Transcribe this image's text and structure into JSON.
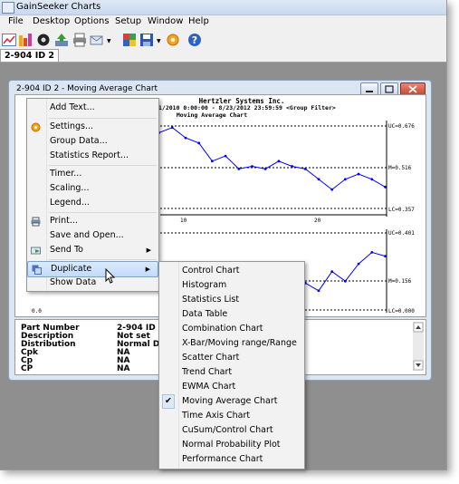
{
  "app": {
    "title": "GainSeeker Charts"
  },
  "menubar": [
    "File",
    "Desktop",
    "Options",
    "Setup",
    "Window",
    "Help"
  ],
  "toolbar_icons": [
    "chart-icon",
    "bar-chart-icon",
    "record-icon",
    "export-icon",
    "print-icon",
    "send-mail-icon",
    "color-grid-icon",
    "save-icon",
    "settings-icon",
    "help-icon"
  ],
  "tab": {
    "label": "2-904 ID 2"
  },
  "child_window": {
    "title": "2-904 ID 2 - Moving Average Chart"
  },
  "chart": {
    "company": "Hertzler Systems Inc.",
    "date_range": "1/2010 0:00:00 - 8/23/2012 23:59:59",
    "group_filter": "<Group Filter>",
    "chart_title": "Moving Average Chart",
    "ucl_label": "UC=0.676",
    "mean_label": "M=0.516",
    "lcl_label": "LC=0.357",
    "range_ucl_label": "UC=0.401",
    "range_mean_label": "M=0.156",
    "range_lcl_label": "LC=0.000",
    "range_zero_tick": "0.0",
    "x_tick_10": "10",
    "x_tick_20": "20"
  },
  "chart_data": {
    "type": "line",
    "title": "Moving Average Chart",
    "series": [
      {
        "name": "",
        "x": [
          7,
          8,
          9,
          10,
          11,
          12,
          13,
          14,
          15,
          16,
          17,
          18,
          19,
          20,
          21,
          22,
          23,
          24,
          25
        ],
        "values": [
          0.62,
          0.65,
          0.67,
          0.63,
          0.61,
          0.54,
          0.56,
          0.51,
          0.52,
          0.51,
          0.54,
          0.52,
          0.51,
          0.47,
          0.43,
          0.47,
          0.49,
          0.47,
          0.44
        ]
      }
    ],
    "ucl": 0.676,
    "center": 0.516,
    "lcl": 0.357,
    "ylim": [
      0.35,
      0.69
    ],
    "range_series": [
      {
        "name": "",
        "x": [
          13,
          14,
          15,
          16,
          17,
          18,
          19,
          20,
          21,
          22,
          23,
          24,
          25
        ],
        "values": [
          0.08,
          0.2,
          0.18,
          0.11,
          0.13,
          0.16,
          0.14,
          0.1,
          0.2,
          0.15,
          0.24,
          0.3,
          0.28
        ]
      }
    ],
    "range_ucl": 0.401,
    "range_center": 0.156,
    "range_lcl": 0.0
  },
  "data_panel": {
    "rows": [
      {
        "label": "Part Number",
        "value": "2-904 ID 2"
      },
      {
        "label": "Description",
        "value": "Not set"
      },
      {
        "label": "Distribution",
        "value": "Normal Di"
      },
      {
        "label": "Cpk",
        "value": "NA"
      },
      {
        "label": "Cp",
        "value": "NA"
      },
      {
        "label": "CP",
        "value": "NA"
      }
    ]
  },
  "context_menu": {
    "items": [
      {
        "label": "Add Text...",
        "icon": ""
      },
      {
        "label": "Settings...",
        "icon": "settings-icon"
      },
      {
        "label": "Group Data...",
        "icon": ""
      },
      {
        "label": "Statistics Report...",
        "icon": ""
      },
      {
        "label": "Timer...",
        "icon": ""
      },
      {
        "label": "Scaling...",
        "icon": ""
      },
      {
        "label": "Legend...",
        "icon": ""
      },
      {
        "label": "Print...",
        "icon": "print-icon"
      },
      {
        "label": "Save and Open...",
        "icon": ""
      },
      {
        "label": "Send To",
        "icon": "send-to-icon",
        "submenu": true
      },
      {
        "label": "Duplicate",
        "icon": "duplicate-icon",
        "submenu": true,
        "highlighted": true
      },
      {
        "label": "Show Data",
        "icon": ""
      }
    ]
  },
  "submenu": {
    "items": [
      {
        "label": "Control Chart"
      },
      {
        "label": "Histogram"
      },
      {
        "label": "Statistics List"
      },
      {
        "label": "Data Table"
      },
      {
        "label": "Combination Chart"
      },
      {
        "label": "X-Bar/Moving range/Range"
      },
      {
        "label": "Scatter Chart"
      },
      {
        "label": "Trend Chart"
      },
      {
        "label": "EWMA Chart"
      },
      {
        "label": "Moving Average Chart",
        "checked": true
      },
      {
        "label": "Time Axis Chart"
      },
      {
        "label": "CuSum/Control Chart"
      },
      {
        "label": "Normal Probability Plot"
      },
      {
        "label": "Performance Chart"
      }
    ]
  },
  "colors": {
    "accent": "#3a6cc0",
    "series": "#0000ff",
    "highlight": "#c1dbfc"
  }
}
